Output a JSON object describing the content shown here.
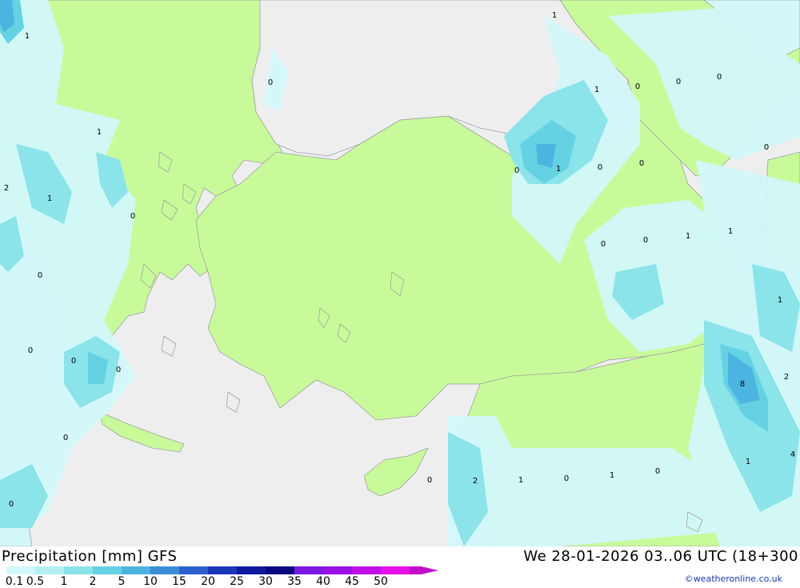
{
  "header": {
    "title": "Precipitation [mm] GFS",
    "valid_time": "We 28-01-2026 03..06 UTC (18+300"
  },
  "legend": {
    "colors": [
      "#d2f8fa",
      "#b4f0f2",
      "#8ae4ea",
      "#64d2e2",
      "#4cb4e0",
      "#3a8ed8",
      "#2c60d0",
      "#1c36b8",
      "#1018a0",
      "#0a0a80",
      "#7a18e0",
      "#9a10e8",
      "#c20ee8",
      "#e80ee8",
      "#c20ec8"
    ],
    "labels": [
      "0.1",
      "0.5",
      "1",
      "2",
      "5",
      "10",
      "15",
      "20",
      "25",
      "30",
      "35",
      "40",
      "45",
      "50"
    ]
  },
  "map": {
    "colors": {
      "sea": "#eeeeee",
      "land": "#c8fa9a",
      "border": "#a0a0a0"
    },
    "values": [
      "1",
      "0",
      "1",
      "2",
      "1",
      "0",
      "0",
      "0",
      "0",
      "0",
      "0",
      "1",
      "1",
      "0",
      "0",
      "0",
      "0",
      "0",
      "0",
      "1",
      "1",
      "1",
      "0",
      "0",
      "0",
      "1",
      "8",
      "2",
      "4",
      "1",
      "0",
      "2",
      "1",
      "0",
      "1",
      "0",
      "0"
    ]
  },
  "credit": "©weatheronline.co.uk"
}
